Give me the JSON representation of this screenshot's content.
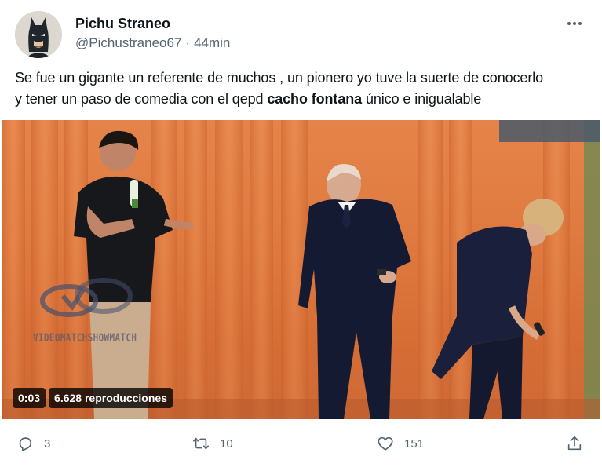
{
  "tweet": {
    "author": {
      "display_name": "Pichu Straneo",
      "handle": "@Pichustraneo67",
      "separator": "·",
      "time": "44min",
      "avatar_icon": "batman-mask-avatar"
    },
    "more_icon": "more-dots-icon",
    "text": {
      "line1": "Se fue un gigante un referente de muchos , un pionero yo tuve la suerte de conocerlo",
      "line2_before": "y tener un paso de comedia con el qepd ",
      "line2_bold": "cacho fontana",
      "line2_after": " único e inigualable"
    },
    "media": {
      "watermark": "VIDEOMATCHSHOWMATCH",
      "duration": "0:03",
      "views": "6.628 reproducciones"
    },
    "actions": {
      "reply_count": "3",
      "retweet_count": "10",
      "like_count": "151"
    }
  },
  "colors": {
    "text_primary": "#0f1419",
    "text_secondary": "#536471",
    "curtain": "#e07d42",
    "badge_bg": "#000000"
  }
}
